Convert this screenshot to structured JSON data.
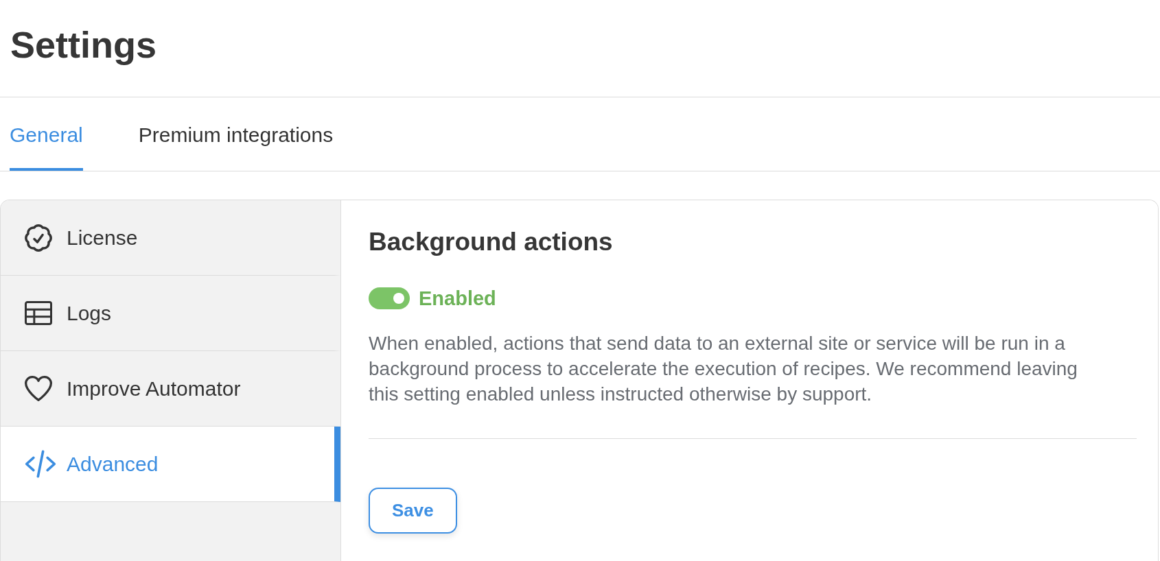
{
  "header": {
    "title": "Settings"
  },
  "tabs": [
    {
      "label": "General",
      "selected": true
    },
    {
      "label": "Premium integrations",
      "selected": false
    }
  ],
  "sidebar": {
    "items": [
      {
        "label": "License",
        "selected": false
      },
      {
        "label": "Logs",
        "selected": false
      },
      {
        "label": "Improve Automator",
        "selected": false
      },
      {
        "label": "Advanced",
        "selected": true
      }
    ]
  },
  "section": {
    "title": "Background actions",
    "toggle": {
      "on": true,
      "label": "Enabled"
    },
    "description": "When enabled, actions that send data to an external site or service will be run in a background process to accelerate the execution of recipes. We recommend leaving this setting enabled unless instructed otherwise by support.",
    "save_button": {
      "label": "Save"
    }
  }
}
